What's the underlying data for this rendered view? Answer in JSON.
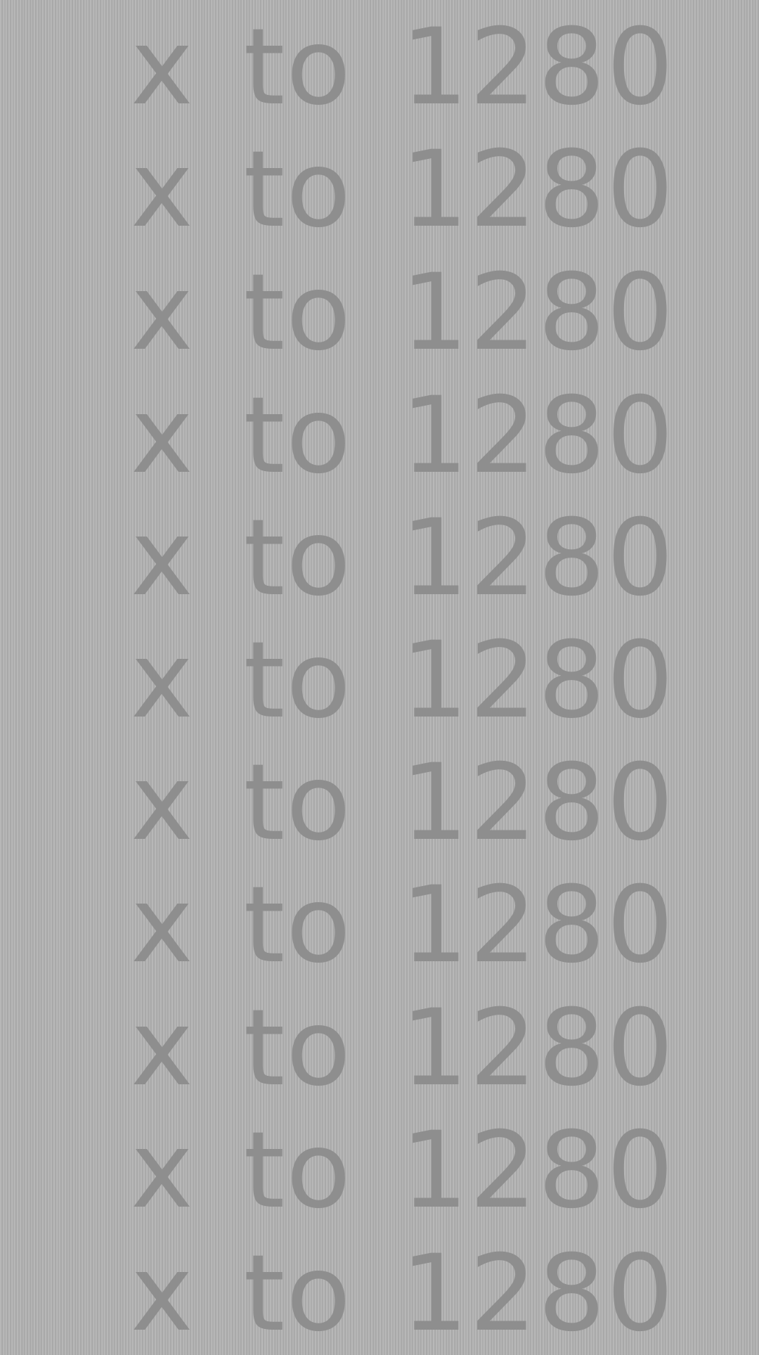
{
  "lines": [
    "x to 1280",
    "x to 1280",
    "x to 1280",
    "x to 1280",
    "x to 1280",
    "x to 1280",
    "x to 1280",
    "x to 1280",
    "x to 1280",
    "x to 1280",
    "x to 1280"
  ],
  "colors": {
    "background": "#b2b2b2",
    "stripe_light": "#b8b8b8",
    "stripe_dark": "#a8a8a8",
    "text": "#8e8e8e"
  }
}
